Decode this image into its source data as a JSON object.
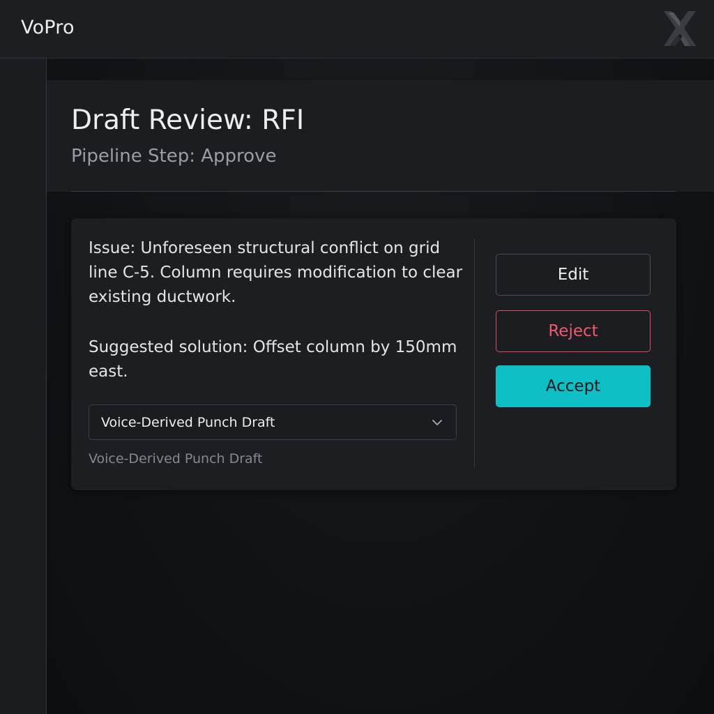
{
  "app": {
    "title": "VoPro",
    "logo_icon": "brand-logo-icon"
  },
  "header": {
    "title": "Draft Review: RFI",
    "subtitle": "Pipeline Step: Approve"
  },
  "card": {
    "issue_text": "Issue: Unforeseen structural conflict on grid line C-5. Column requires modification to clear existing ductwork.",
    "solution_text": "Suggested solution: Offset column by 150mm east.",
    "select": {
      "value": "Voice-Derived Punch Draft",
      "icon": "chevron-down-icon"
    },
    "helper_text": "Voice-Derived Punch Draft"
  },
  "actions": {
    "edit_label": "Edit",
    "reject_label": "Reject",
    "accept_label": "Accept"
  },
  "colors": {
    "background": "#0f1114",
    "panel": "#1c1e21",
    "accent": "#0fbfc6",
    "danger": "#ef5a6e",
    "text_primary": "#eceef0",
    "text_secondary": "#9a9ea3"
  }
}
